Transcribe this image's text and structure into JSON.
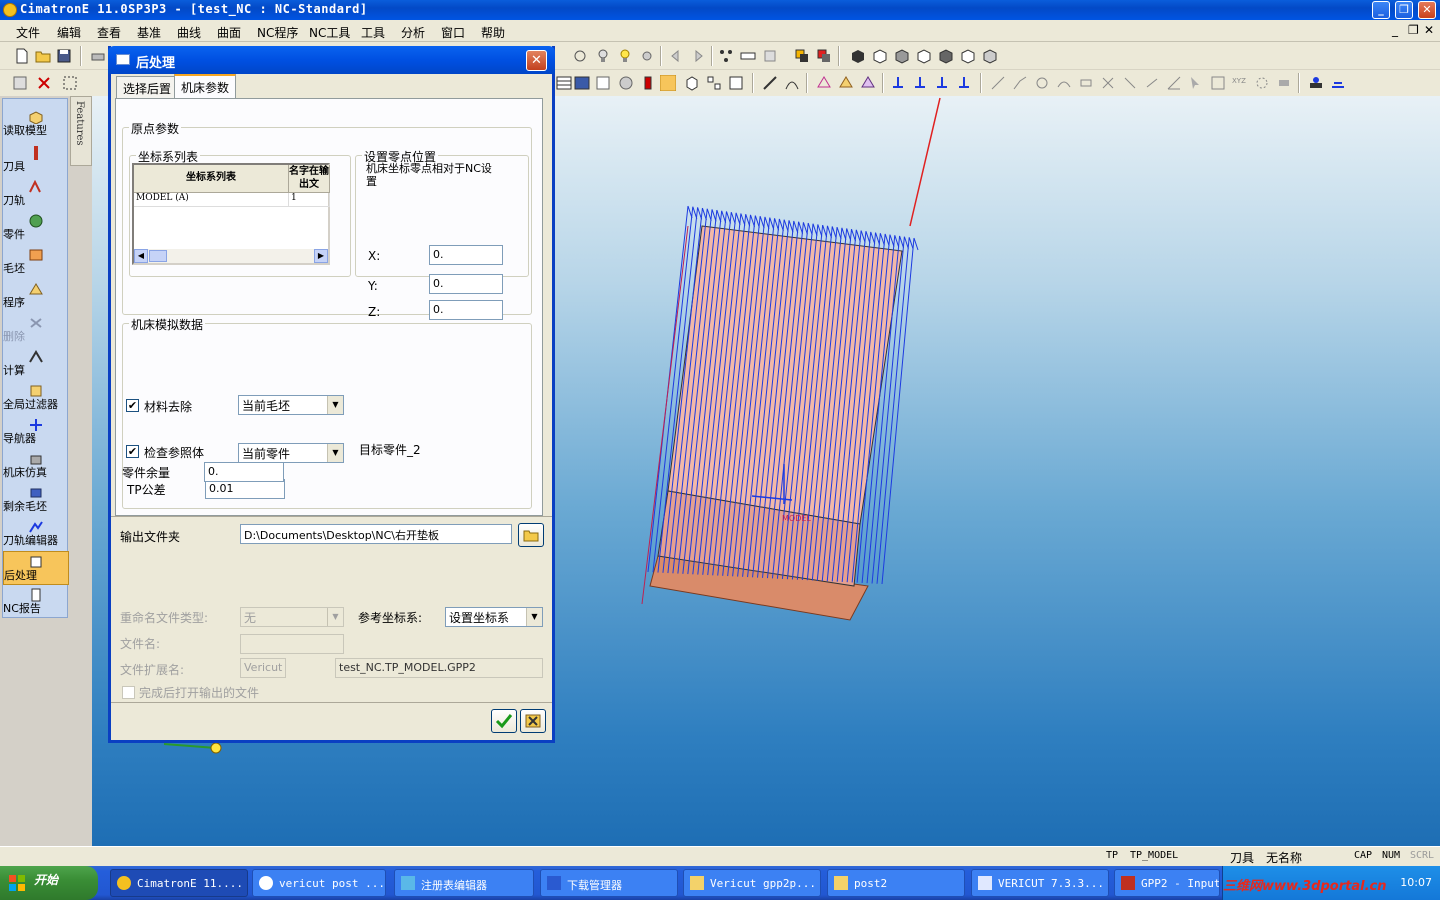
{
  "window": {
    "title": "CimatronE 11.0SP3P3 - [test_NC : NC-Standard]",
    "minimize": "_",
    "restore": "❐",
    "close": "✕"
  },
  "menu": {
    "items": [
      "文件",
      "编辑",
      "查看",
      "基准",
      "曲线",
      "曲面",
      "NC程序",
      "NC工具",
      "工具",
      "分析",
      "窗口",
      "帮助"
    ],
    "mdi_controls": [
      "_",
      "❐",
      "✕"
    ]
  },
  "left_panel": {
    "features_tab": "Features",
    "items": [
      {
        "label": "读取模型",
        "icon": "read-model-icon"
      },
      {
        "label": "刀具",
        "icon": "tool-icon"
      },
      {
        "label": "刀轨",
        "icon": "toolpath-icon"
      },
      {
        "label": "零件",
        "icon": "part-icon"
      },
      {
        "label": "毛坯",
        "icon": "stock-icon"
      },
      {
        "label": "程序",
        "icon": "procedure-icon"
      },
      {
        "label": "删除",
        "icon": "delete-icon"
      },
      {
        "label": "计算",
        "icon": "calculate-icon"
      },
      {
        "label": "全局过滤器",
        "icon": "global-filter-icon"
      },
      {
        "label": "导航器",
        "icon": "navigator-icon"
      },
      {
        "label": "机床仿真",
        "icon": "machine-sim-icon"
      },
      {
        "label": "剩余毛坯",
        "icon": "remaining-stock-icon"
      },
      {
        "label": "刀轨编辑器",
        "icon": "toolpath-editor-icon"
      },
      {
        "label": "后处理",
        "icon": "post-process-icon"
      },
      {
        "label": "NC报告",
        "icon": "nc-report-icon"
      }
    ]
  },
  "dialog": {
    "title": "后处理",
    "close": "✕",
    "tabs": [
      "选择后置",
      "机床参数"
    ],
    "selected_tab": "机床参数",
    "origin_group": {
      "title": "原点参数",
      "coord_list_title": "坐标系列表",
      "table_headers": [
        "坐标系列表",
        "名字在输出文"
      ],
      "table_rows": [
        [
          "MODEL (A)",
          "1"
        ]
      ],
      "zero_group_title": "设置零点位置",
      "zero_note": "机床坐标零点相对于NC设置",
      "x_label": "X:",
      "x_value": "0.",
      "y_label": "Y:",
      "y_value": "0.",
      "z_label": "Z:",
      "z_value": "0."
    },
    "sim_group": {
      "title": "机床模拟数据",
      "material_removal_label": "材料去除",
      "material_removal_checked": "✔",
      "material_removal_value": "当前毛坯",
      "check_ref_label": "检查参照体",
      "check_ref_checked": "✔",
      "check_ref_value": "当前零件",
      "target_part": "目标零件_2",
      "tp_tol_label": "TP公差",
      "tp_tol_value": "0.01",
      "part_allow_label": "零件余量",
      "part_allow_value": "0."
    },
    "output_folder_label": "输出文件夹",
    "output_folder_value": "D:\\Documents\\Desktop\\NC\\右开垫板",
    "rename_type_label": "重命名文件类型:",
    "rename_type_value": "无",
    "ref_coord_label": "参考坐标系:",
    "ref_coord_value": "设置坐标系",
    "file_name_label": "文件名:",
    "file_name_value": "",
    "file_ext_label": "文件扩展名:",
    "file_ext_value": "Vericut",
    "file_full_value": "test_NC.TP_MODEL.GPP2",
    "open_after_label": "完成后打开输出的文件"
  },
  "status_bar": {
    "tp": "TP",
    "tp_model": "TP_MODEL",
    "tool": "刀具",
    "noname": "无名称",
    "cap": "CAP",
    "num": "NUM",
    "scrl": "SCRL"
  },
  "taskbar": {
    "start": "开始",
    "tasks": [
      "CimatronE 11....",
      "vericut post ...",
      "注册表编辑器",
      "下载管理器",
      "Vericut gpp2p...",
      "post2",
      "VERICUT 7.3.3...",
      "GPP2 - Input ..."
    ],
    "tray_watermark": "三维网www.3dportal.cn",
    "clock": "10:07"
  },
  "colors": {
    "title_blue": "#0054e3",
    "toolpath_blue": "#1c3ae0",
    "part_salmon": "#e8a08f",
    "stock_orange": "#d98b6a",
    "axis_red": "#e02020"
  }
}
